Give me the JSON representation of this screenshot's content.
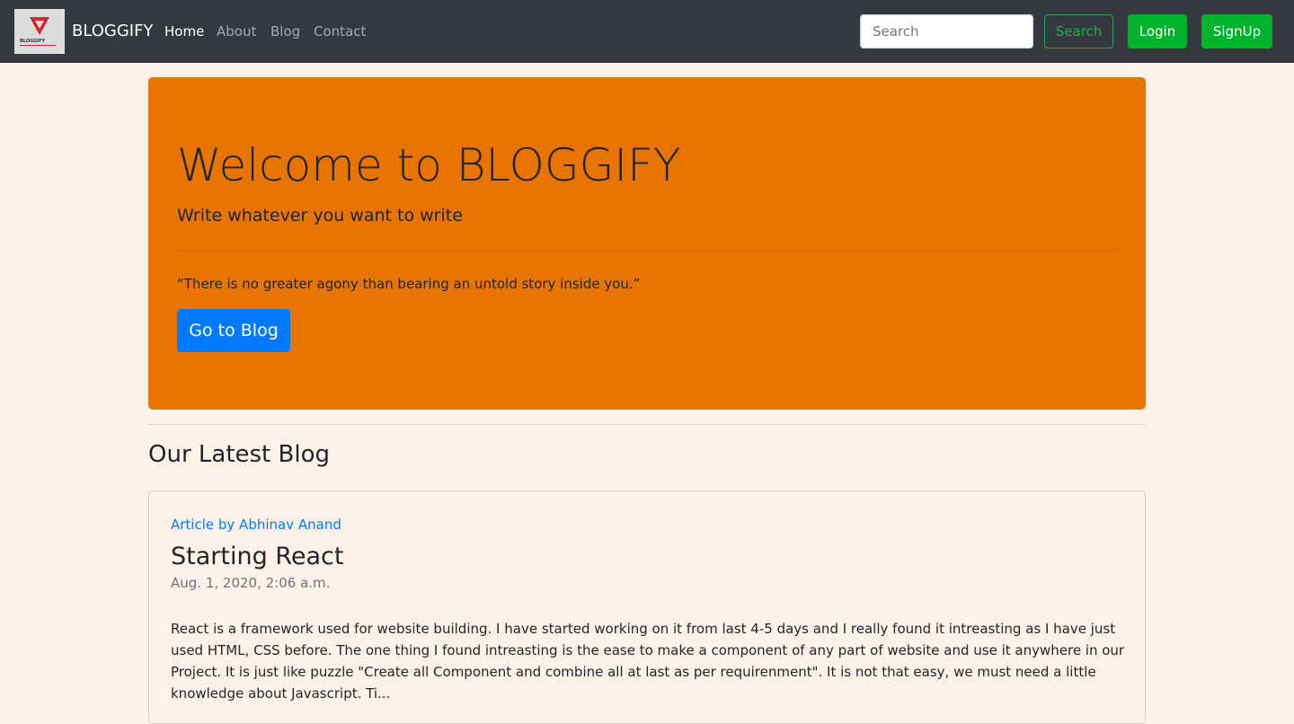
{
  "navbar": {
    "brand_logo_text": "BLOGGIFY",
    "brand_name": "BLOGGIFY",
    "links": [
      {
        "label": "Home",
        "active": true
      },
      {
        "label": "About",
        "active": false
      },
      {
        "label": "Blog",
        "active": false
      },
      {
        "label": "Contact",
        "active": false
      }
    ],
    "search_placeholder": "Search",
    "search_button": "Search",
    "login_button": "Login",
    "signup_button": "SignUp"
  },
  "jumbotron": {
    "title": "Welcome to BLOGGIFY",
    "lead": "Write whatever you want to write",
    "quote": "“There is no greater agony than bearing an untold story inside you.”",
    "button": "Go to Blog"
  },
  "latest": {
    "section_title": "Our Latest Blog",
    "post": {
      "author": "Article by Abhinav Anand",
      "title": "Starting React",
      "date": "Aug. 1, 2020, 2:06 a.m.",
      "excerpt": "React is a framework used for website building. I have started working on it from last 4-5 days and I really found it intreasting as I have just used HTML, CSS before. The one thing I found intreasting is the ease to make a component of any part of website and use it anywhere in our Project. It is just like puzzle \"Create all Component and combine all at last as per requirenment\". It is not that easy, we must need a little knowledge about Javascript. Ti..."
    }
  },
  "colors": {
    "navbar_bg": "#343a40",
    "page_bg": "#fef1e9",
    "jumbotron_bg": "#e87400",
    "primary": "#007bff",
    "success": "#00b32c"
  }
}
